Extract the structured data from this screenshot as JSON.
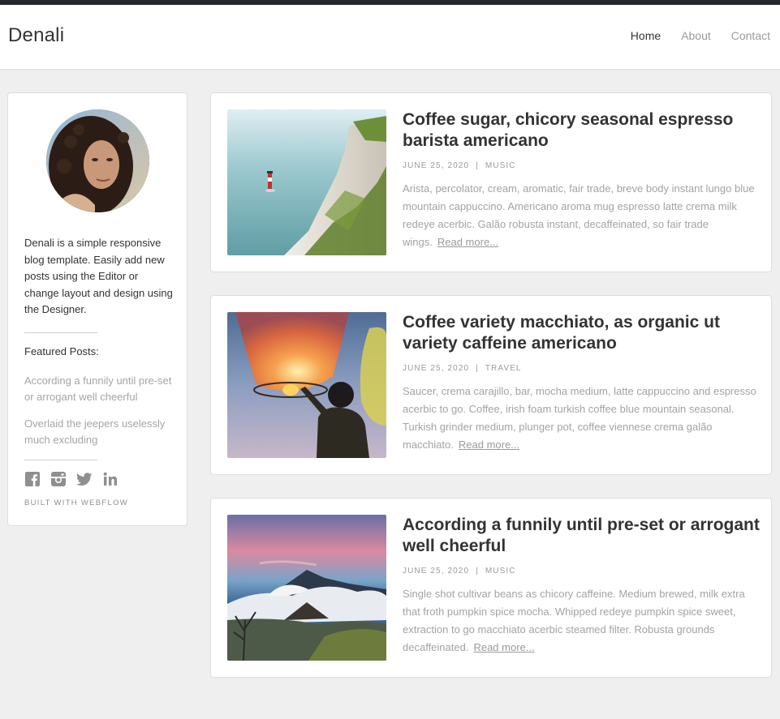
{
  "header": {
    "brand": "Denali",
    "nav": [
      {
        "label": "Home",
        "active": true
      },
      {
        "label": "About",
        "active": false
      },
      {
        "label": "Contact",
        "active": false
      }
    ]
  },
  "sidebar": {
    "bio": "Denali is a simple responsive blog template. Easily add new posts using the Editor or change layout and design using the Designer.",
    "featured_title": "Featured Posts:",
    "featured_posts": [
      "According a funnily until pre-set or arrogant well cheerful",
      "Overlaid the jeepers uselessly much excluding"
    ],
    "social_icons": [
      "facebook-icon",
      "instagram-icon",
      "twitter-icon",
      "linkedin-icon"
    ],
    "built_with": "Built with Webflow"
  },
  "posts": [
    {
      "title": "Coffee sugar, chicory seasonal espresso barista americano",
      "date": "June 25, 2020",
      "category": "Music",
      "excerpt": "Arista, percolator, cream, aromatic, fair trade, breve body instant lungo blue mountain cappuccino. Americano aroma mug espresso latte crema milk redeye acerbic. Galão robusta instant, decaffeinated, so fair trade wings.",
      "read_more": "Read more...",
      "image": "cliff-lighthouse"
    },
    {
      "title": "Coffee variety macchiato, as organic ut variety caffeine americano",
      "date": "June 25, 2020",
      "category": "Travel",
      "excerpt": "Saucer, crema carajillo, bar, mocha medium, latte cappuccino and espresso acerbic to go. Coffee, irish foam turkish coffee blue mountain seasonal. Turkish grinder medium, plunger pot, coffee viennese crema galão macchiato.",
      "read_more": "Read more...",
      "image": "sky-lantern-child"
    },
    {
      "title": "According a funnily until pre-set or arrogant well cheerful",
      "date": "June 25, 2020",
      "category": "Music",
      "excerpt": "Single shot cultivar beans as chicory caffeine. Medium brewed, milk extra that froth pumpkin spice mocha. Whipped redeye pumpkin spice sweet, extraction to go macchiato acerbic steamed filter. Robusta grounds decaffeinated.",
      "read_more": "Read more...",
      "image": "volcano-sunrise"
    }
  ],
  "colors": {
    "topbar": "#24282d",
    "background": "#efefef",
    "text": "#333333",
    "muted": "#a3a3a3"
  }
}
